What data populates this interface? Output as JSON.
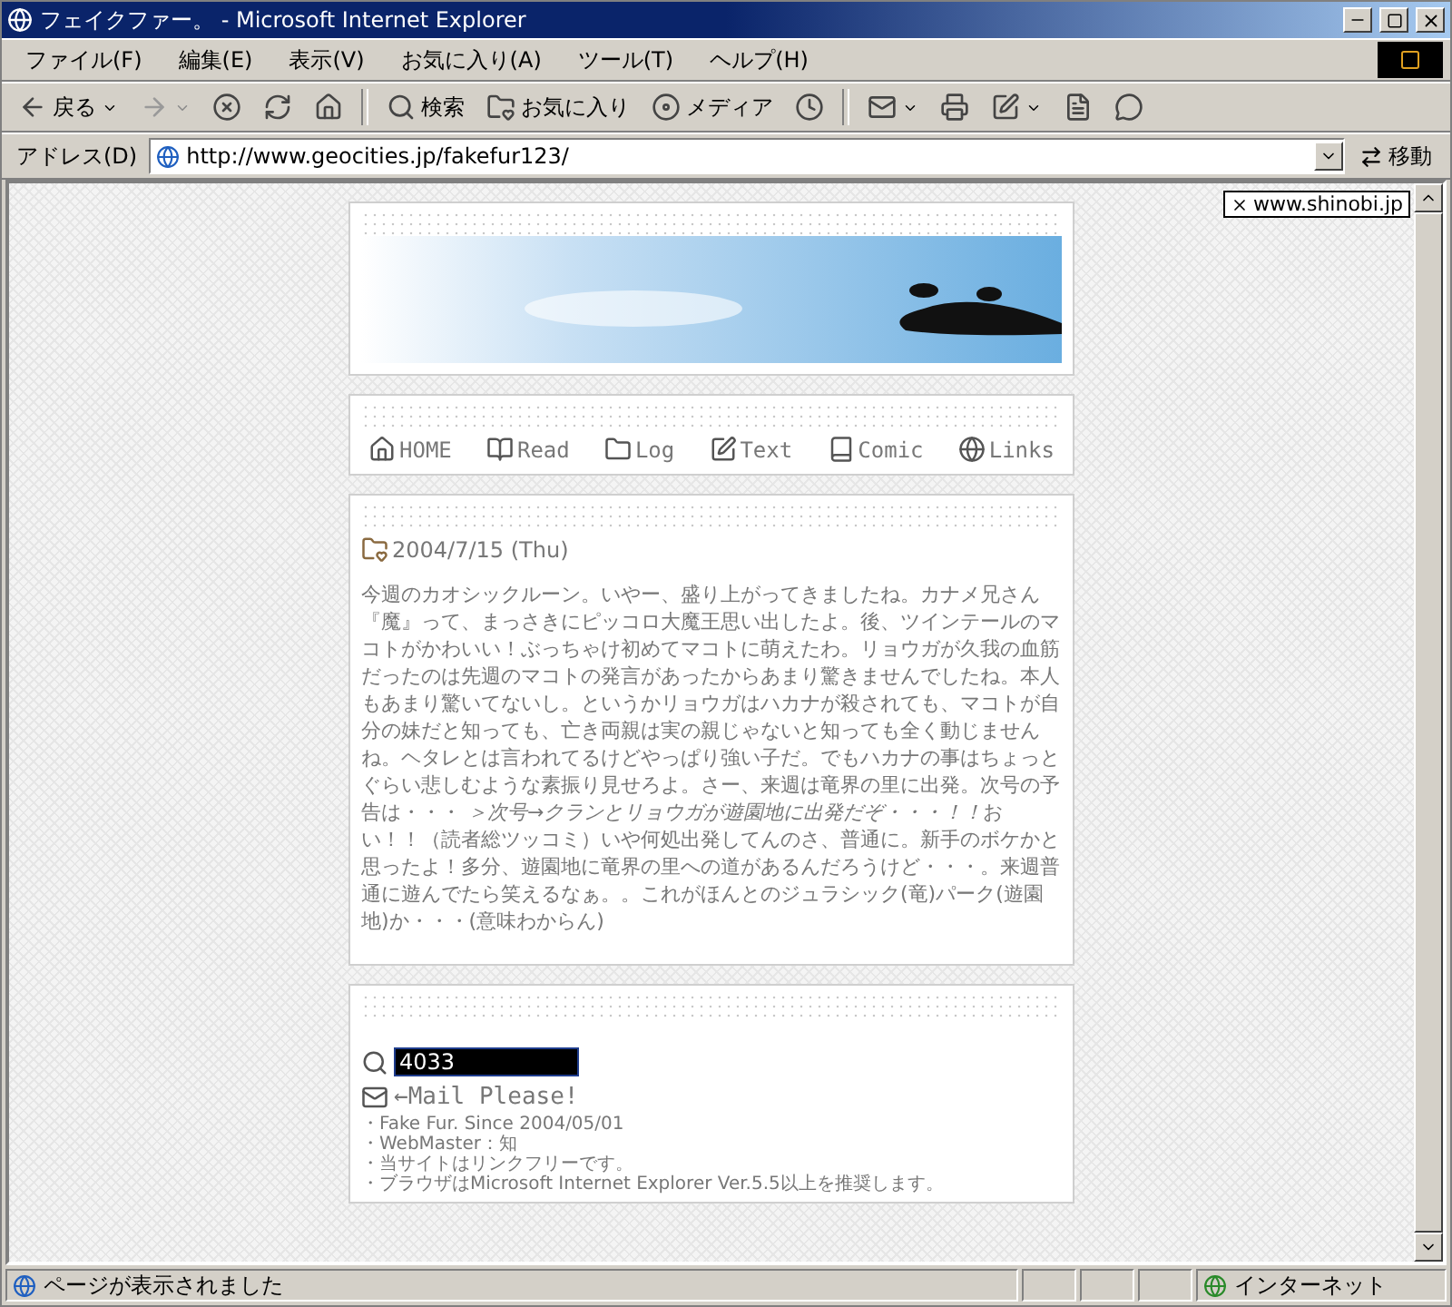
{
  "window": {
    "title": "フェイクファー。 - Microsoft Internet Explorer"
  },
  "menu": [
    "ファイル(F)",
    "編集(E)",
    "表示(V)",
    "お気に入り(A)",
    "ツール(T)",
    "ヘルプ(H)"
  ],
  "toolbar": [
    {
      "kind": "back",
      "label": "戻る",
      "dropdown": true,
      "disabled": false
    },
    {
      "kind": "forward",
      "dropdown": true,
      "disabled": true
    },
    {
      "kind": "stop",
      "dropdown": false,
      "disabled": false
    },
    {
      "kind": "refresh",
      "dropdown": false,
      "disabled": false
    },
    {
      "kind": "home",
      "dropdown": false,
      "disabled": false
    },
    {
      "kind": "search",
      "label": "検索",
      "dropdown": false,
      "disabled": false
    },
    {
      "kind": "favorites",
      "label": "お気に入り",
      "dropdown": false,
      "disabled": false
    },
    {
      "kind": "media",
      "label": "メディア",
      "dropdown": false,
      "disabled": false
    },
    {
      "kind": "history",
      "dropdown": false,
      "disabled": false
    },
    {
      "kind": "mail",
      "dropdown": true,
      "disabled": false
    },
    {
      "kind": "print",
      "dropdown": false,
      "disabled": false
    },
    {
      "kind": "edit",
      "dropdown": true,
      "disabled": false
    },
    {
      "kind": "discuss",
      "dropdown": false,
      "disabled": false
    },
    {
      "kind": "messenger",
      "dropdown": false,
      "disabled": false
    }
  ],
  "address": {
    "label": "アドレス(D)",
    "value": "http://www.geocities.jp/fakefur123/",
    "go": "移動"
  },
  "badge": "www.shinobi.jp",
  "nav": [
    {
      "kind": "home",
      "label": "HOME"
    },
    {
      "kind": "read",
      "label": "Read"
    },
    {
      "kind": "log",
      "label": "Log"
    },
    {
      "kind": "text",
      "label": "Text"
    },
    {
      "kind": "comic",
      "label": "Comic"
    },
    {
      "kind": "links",
      "label": "Links"
    }
  ],
  "article": {
    "date": "2004/7/15 (Thu)",
    "body": [
      "今週のカオシックルーン。いやー、盛り上がってきましたね。カナメ兄さん『魔』って、まっさきにピッコロ大魔王思い出したよ。後、ツインテールのマコトがかわいい！ぶっちゃけ初めてマコトに萌えたわ。リョウガが久我の血筋だったのは先週のマコトの発言があったからあまり驚きませんでしたね。本人もあまり驚いてないし。というかリョウガはハカナが殺されても、マコトが自分の妹だと知っても、亡き両親は実の親じゃないと知っても全く動じませんね。ヘタレとは言われてるけどやっぱり強い子だ。でもハカナの事はちょっとぐらい悲しむような素振り見せろよ。さー、来週は竜界の里に出発。次号の予告は・・・ ",
      "＞次号→クランとリョウガが遊園地に出発だぞ・・・！！",
      "おい！！（読者総ツッコミ）いや何処出発してんのさ、普通に。新手のボケかと思ったよ！多分、遊園地に竜界の里への道があるんだろうけど・・・。来週普通に遊んでたら笑えるなぁ。。これがほんとのジュラシック(竜)パーク(遊園地)か・・・(意味わからん)"
    ]
  },
  "footer": {
    "counter": "4033",
    "mail": "←Mail Please!",
    "info": [
      "・Fake Fur. Since 2004/05/01",
      "・WebMaster：知",
      "・当サイトはリンクフリーです。",
      "・ブラウザはMicrosoft Internet Explorer Ver.5.5以上を推奨します。"
    ]
  },
  "status_bar": {
    "text": "ページが表示されました",
    "zone": "インターネット"
  }
}
